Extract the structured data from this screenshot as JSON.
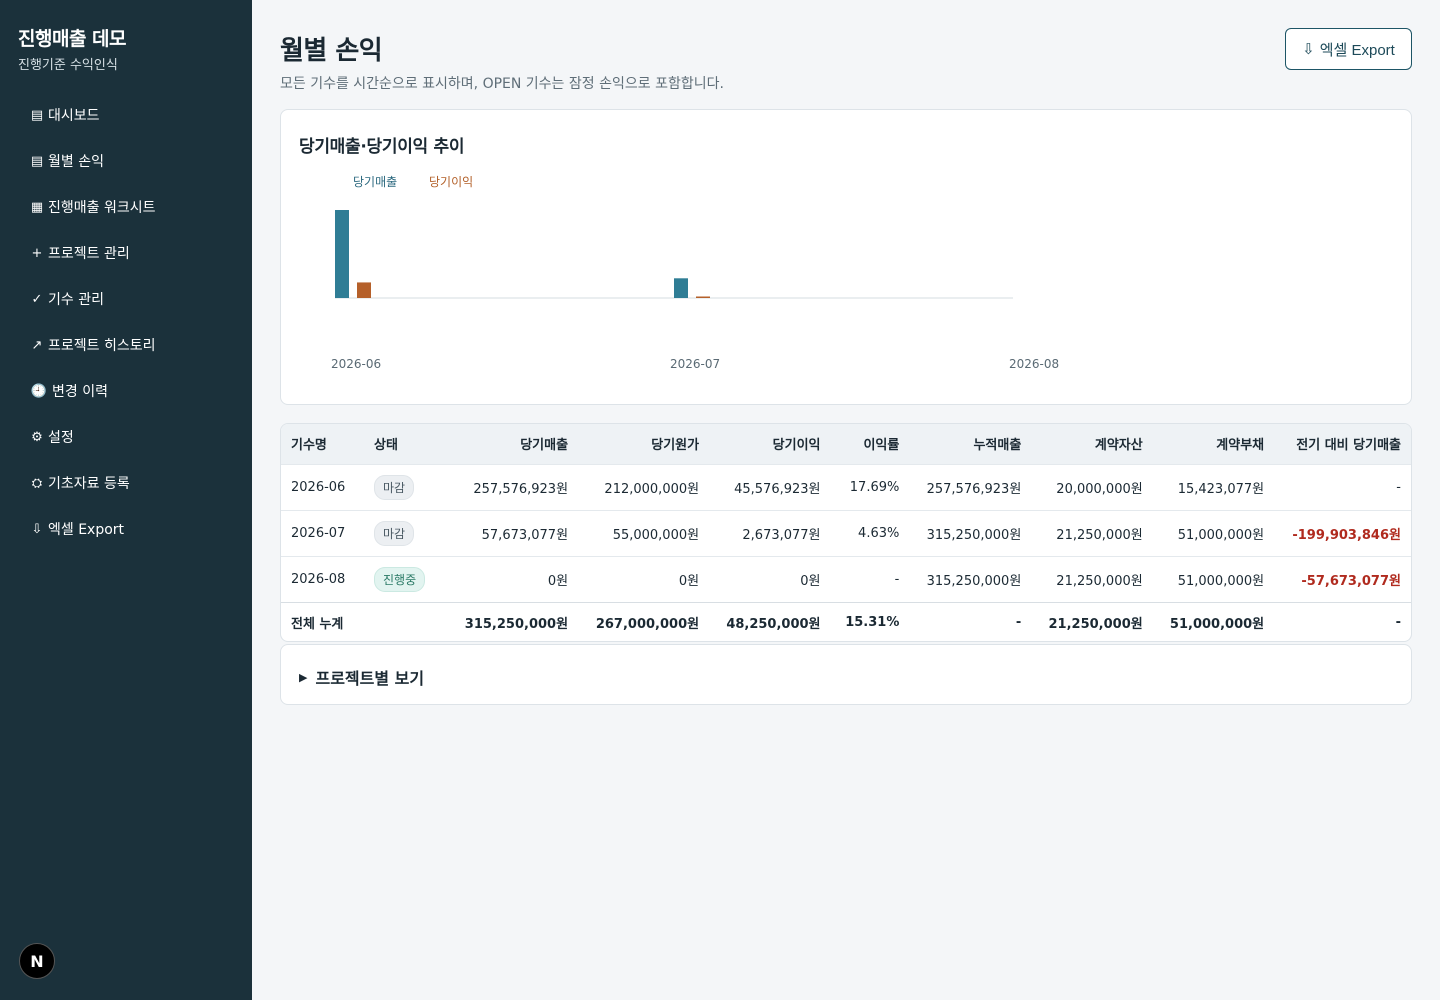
{
  "sidebar": {
    "title": "진행매출 데모",
    "subtitle": "진행기준 수익인식",
    "items": [
      {
        "label": "대시보드",
        "icon": "▤",
        "icon_name": "list-icon"
      },
      {
        "label": "월별 손익",
        "icon": "▤",
        "icon_name": "list-icon"
      },
      {
        "label": "진행매출 워크시트",
        "icon": "▦",
        "icon_name": "grid-icon"
      },
      {
        "label": "프로젝트 관리",
        "icon": "+",
        "icon_name": "plus-icon"
      },
      {
        "label": "기수 관리",
        "icon": "✓",
        "icon_name": "check-icon"
      },
      {
        "label": "프로젝트 히스토리",
        "icon": "↗",
        "icon_name": "trend-arrow-icon"
      },
      {
        "label": "변경 이력",
        "icon": "🕘",
        "icon_name": "clock-icon"
      },
      {
        "label": "설정",
        "icon": "⚙",
        "icon_name": "gear-icon"
      },
      {
        "label": "기초자료 등록",
        "icon": "⛭",
        "icon_name": "cog-icon"
      },
      {
        "label": "엑셀 Export",
        "icon": "⇩",
        "icon_name": "download-arrow-icon"
      }
    ],
    "badge_letter": "N"
  },
  "header": {
    "title": "월별 손익",
    "description": "모든 기수를 시간순으로 표시하며, OPEN 기수는 잠정 손익으로 포함합니다.",
    "export_label": "엑셀 Export",
    "export_icon": "⇩"
  },
  "chart_data": {
    "type": "bar",
    "title": "당기매출·당기이익 추이",
    "categories": [
      "2026-06",
      "2026-07",
      "2026-08"
    ],
    "series": [
      {
        "name": "당기매출",
        "values": [
          257576923,
          57673077,
          0
        ],
        "color": "#2f7d95"
      },
      {
        "name": "당기이익",
        "values": [
          45576923,
          2673077,
          0
        ],
        "color": "#b5602a"
      }
    ],
    "legend": "top-left",
    "grid": false
  },
  "table": {
    "headers": [
      "기수명",
      "상태",
      "당기매출",
      "당기원가",
      "당기이익",
      "이익률",
      "누적매출",
      "계약자산",
      "계약부채",
      "전기 대비 당기매출"
    ],
    "rows": [
      {
        "period": "2026-06",
        "status": "마감",
        "status_open": false,
        "revenue": "257,576,923원",
        "cost": "212,000,000원",
        "profit": "45,576,923원",
        "margin": "17.69%",
        "cum_revenue": "257,576,923원",
        "contract_asset": "20,000,000원",
        "contract_liability": "15,423,077원",
        "diff": "-",
        "diff_negative": false
      },
      {
        "period": "2026-07",
        "status": "마감",
        "status_open": false,
        "revenue": "57,673,077원",
        "cost": "55,000,000원",
        "profit": "2,673,077원",
        "margin": "4.63%",
        "cum_revenue": "315,250,000원",
        "contract_asset": "21,250,000원",
        "contract_liability": "51,000,000원",
        "diff": "-199,903,846원",
        "diff_negative": true
      },
      {
        "period": "2026-08",
        "status": "진행중",
        "status_open": true,
        "revenue": "0원",
        "cost": "0원",
        "profit": "0원",
        "margin": "-",
        "cum_revenue": "315,250,000원",
        "contract_asset": "21,250,000원",
        "contract_liability": "51,000,000원",
        "diff": "-57,673,077원",
        "diff_negative": true
      }
    ],
    "total": {
      "label": "전체 누계",
      "revenue": "315,250,000원",
      "cost": "267,000,000원",
      "profit": "48,250,000원",
      "margin": "15.31%",
      "cum_revenue": "-",
      "contract_asset": "21,250,000원",
      "contract_liability": "51,000,000원",
      "diff": "-"
    }
  },
  "project_section": {
    "label": "프로젝트별 보기",
    "toggle_icon": "▶"
  }
}
